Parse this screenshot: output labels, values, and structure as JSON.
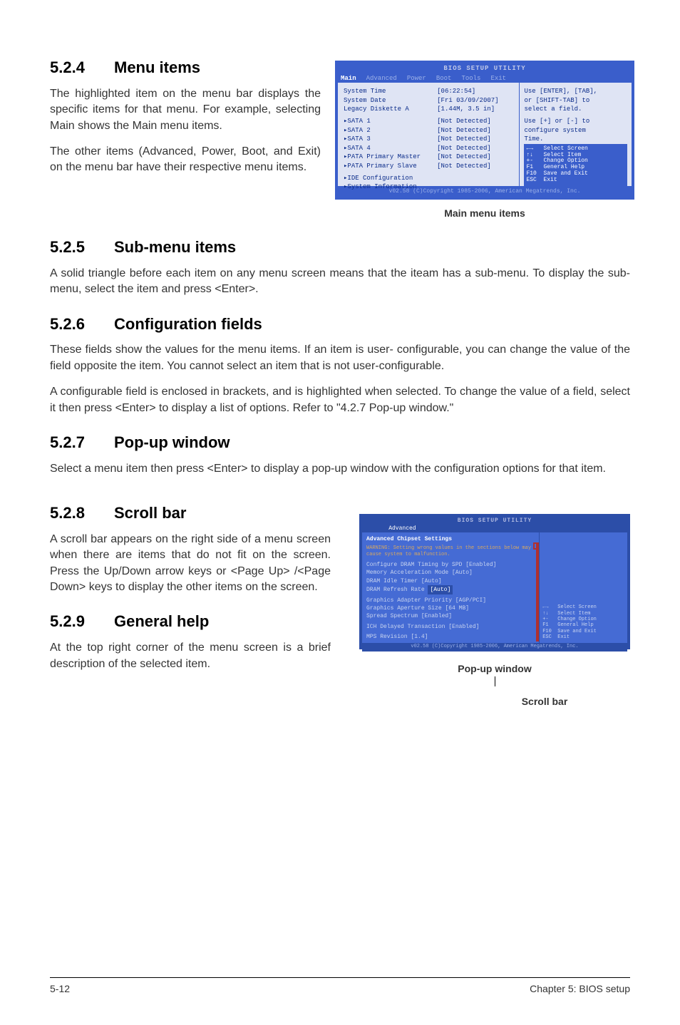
{
  "s524": {
    "num": "5.2.4",
    "title": "Menu items",
    "p1": "The highlighted item on the menu bar displays the specific items for that menu. For example, selecting Main shows the Main menu items.",
    "p2": "The other items (Advanced, Power, Boot, and Exit) on the menu bar have their respective menu items."
  },
  "bios1": {
    "title": "BIOS SETUP UTILITY",
    "tabs": {
      "main": "Main",
      "adv": "Advanced",
      "pwr": "Power",
      "boot": "Boot",
      "tools": "Tools",
      "exit": "Exit"
    },
    "rows": [
      {
        "l": "System Time",
        "v": "[06:22:54]"
      },
      {
        "l": "System Date",
        "v": "[Fri 03/09/2007]"
      },
      {
        "l": "Legacy Diskette A",
        "v": "[1.44M, 3.5 in]"
      }
    ],
    "subs": [
      {
        "l": "SATA 1",
        "v": "[Not Detected]"
      },
      {
        "l": "SATA 2",
        "v": "[Not Detected]"
      },
      {
        "l": "SATA 3",
        "v": "[Not Detected]"
      },
      {
        "l": "SATA 4",
        "v": "[Not Detected]"
      },
      {
        "l": "PATA Primary Master",
        "v": "[Not Detected]"
      },
      {
        "l": "PATA Primary Slave",
        "v": "[Not Detected]"
      }
    ],
    "extra1": "IDE Configuration",
    "extra2": "System Information",
    "help1": "Use [ENTER], [TAB],",
    "help2": "or [SHIFT-TAB] to",
    "help3": "select a field.",
    "help4": "Use [+] or [-] to",
    "help5": "configure system",
    "help6": "Time.",
    "keys": "←→   Select Screen\n↑↓   Select Item\n+-   Change Option\nF1   General Help\nF10  Save and Exit\nESC  Exit",
    "footer": "v02.58 (C)Copyright 1985-2006, American Megatrends, Inc."
  },
  "caption1": "Main menu items",
  "s525": {
    "num": "5.2.5",
    "title": "Sub-menu items",
    "p": "A solid triangle before each item on any menu screen means that the iteam has a sub-menu. To display the sub-menu, select the item and press <Enter>."
  },
  "s526": {
    "num": "5.2.6",
    "title": "Configuration fields",
    "p1": "These fields show the values for the menu items. If an item is user- configurable, you can change the value of the field opposite the item. You cannot select an item that is not user-configurable.",
    "p2": "A configurable field is enclosed in brackets, and is highlighted when selected. To change the value of a field, select it then press <Enter> to display a list of options. Refer to \"4.2.7 Pop-up window.\""
  },
  "s527": {
    "num": "5.2.7",
    "title": "Pop-up window",
    "p": "Select a menu item then press <Enter> to display a pop-up window with the configuration options for that item."
  },
  "s528": {
    "num": "5.2.8",
    "title": "Scroll bar",
    "p": "A scroll bar appears on the right side of a menu screen when there are items that do not fit on the screen. Press the Up/Down arrow keys or <Page Up> /<Page Down> keys to display the other items on the screen."
  },
  "s529": {
    "num": "5.2.9",
    "title": "General help",
    "p": "At the top right corner of the menu screen is a brief description of the selected item."
  },
  "bios2": {
    "title": "BIOS SETUP UTILITY",
    "tab": "Advanced",
    "hdr": "Advanced Chipset Settings",
    "warn": "WARNING: Setting wrong values in the sections below may cause system to malfunction.",
    "lines": [
      {
        "l": "Configure DRAM Timing by SPD",
        "v": "[Enabled]"
      },
      {
        "l": "Memory Acceleration Mode",
        "v": "[Auto]"
      },
      {
        "l": "DRAM Idle Timer",
        "v": "[Auto]"
      },
      {
        "l": "DRAM Refresh Rate",
        "v": "[Auto]",
        "box": true
      },
      {
        "l": "Graphics Adapter Priority",
        "v": "[AGP/PCI]"
      },
      {
        "l": "Graphics Aperture Size",
        "v": "[64 MB]"
      },
      {
        "l": "Spread Spectrum",
        "v": "[Enabled]"
      },
      {
        "l": "ICH Delayed Transaction",
        "v": "[Enabled]"
      },
      {
        "l": "MPS Revision",
        "v": "[1.4]"
      }
    ],
    "keys": "←→   Select Screen\n↑↓   Select Item\n+-   Change Option\nF1   General Help\nF10  Save and Exit\nESC  Exit",
    "footer": "v02.58 (C)Copyright 1985-2006, American Megatrends, Inc."
  },
  "caption2": "Pop-up window",
  "caption3": "Scroll bar",
  "footer": {
    "left": "5-12",
    "right": "Chapter 5: BIOS setup"
  }
}
